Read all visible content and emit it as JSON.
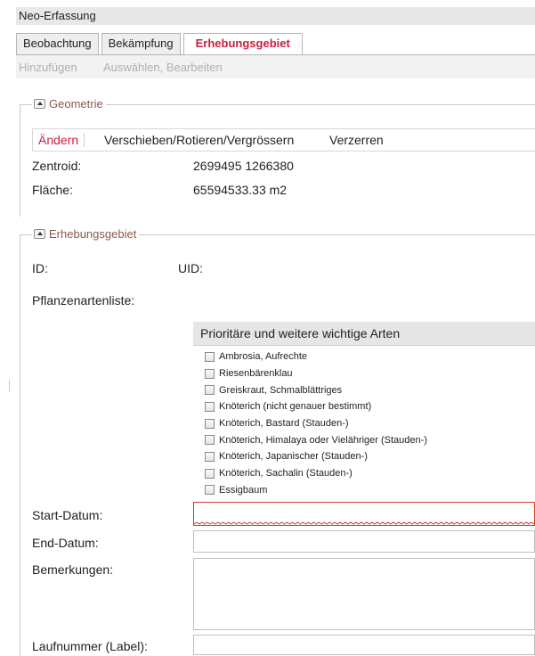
{
  "window": {
    "title": "Neo-Erfassung"
  },
  "tabs": [
    {
      "label": "Beobachtung"
    },
    {
      "label": "Bekämpfung"
    },
    {
      "label": "Erhebungsgebiet"
    }
  ],
  "toolbar": {
    "add": "Hinzufügen",
    "select_edit": "Auswählen, Bearbeiten"
  },
  "geometry": {
    "legend": "Geometrie",
    "tools": [
      "Ändern",
      "Verschieben/Rotieren/Vergrössern",
      "Verzerren"
    ],
    "centroid_label": "Zentroid:",
    "centroid_value": "2699495 1266380",
    "area_label": "Fläche:",
    "area_value": "65594533.33 m2"
  },
  "survey": {
    "legend": "Erhebungsgebiet",
    "id_label": "ID:",
    "uid_label": "UID:",
    "plant_list_label": "Pflanzenartenliste:",
    "plant_list_header": "Prioritäre und weitere wichtige Arten",
    "plants": [
      "Ambrosia, Aufrechte",
      "Riesenbärenklau",
      "Greiskraut, Schmalblättriges",
      "Knöterich (nicht genauer bestimmt)",
      "Knöterich, Bastard (Stauden-)",
      "Knöterich, Himalaya oder Vielähriger (Stauden-)",
      "Knöterich, Japanischer (Stauden-)",
      "Knöterich, Sachalin (Stauden-)",
      "Essigbaum"
    ],
    "start_label": "Start-Datum:",
    "start_value": "",
    "end_label": "End-Datum:",
    "end_value": "",
    "remarks_label": "Bemerkungen:",
    "remarks_value": "",
    "label_no_label": "Laufnummer (Label):",
    "label_no_value": ""
  },
  "colors": {
    "accent": "#cc1d3b",
    "legend": "#8a5a4a",
    "invalid": "#d03c2a"
  }
}
